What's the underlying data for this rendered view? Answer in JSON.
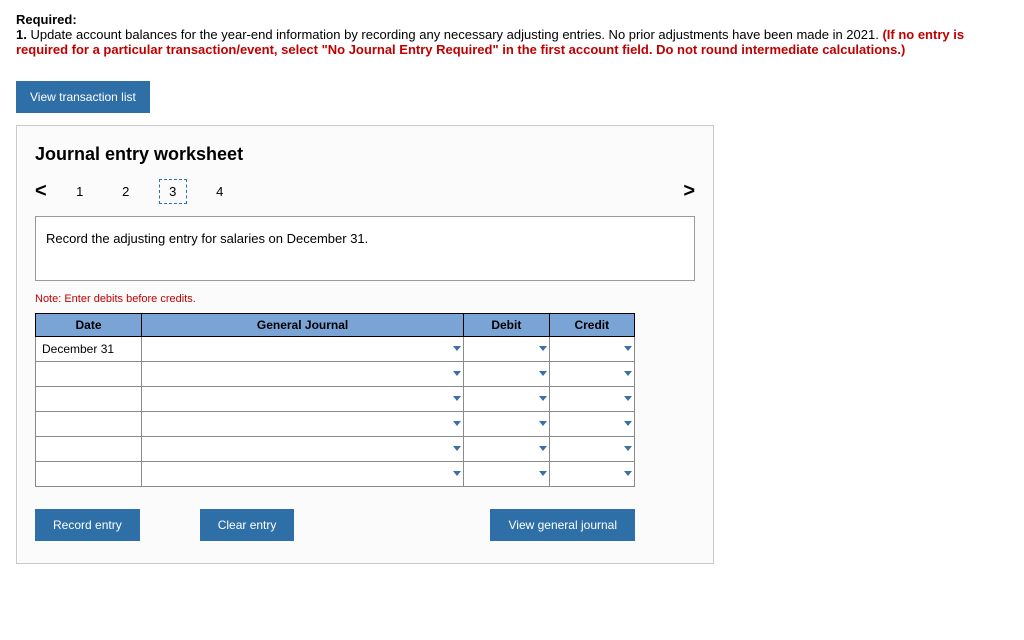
{
  "required": {
    "heading": "Required:",
    "item_num": "1.",
    "text_a": " Update account balances for the year-end information by recording any necessary adjusting entries. No prior adjustments have been made in 2021. ",
    "text_red": "(If no entry is required for a particular transaction/event, select \"No Journal Entry Required\" in the first account field. Do not round intermediate calculations.)"
  },
  "buttons": {
    "view_transaction_list": "View transaction list",
    "record_entry": "Record entry",
    "clear_entry": "Clear entry",
    "view_general_journal": "View general journal"
  },
  "worksheet": {
    "title": "Journal entry worksheet",
    "pager": {
      "prev": "<",
      "next": ">",
      "steps": [
        "1",
        "2",
        "3",
        "4"
      ],
      "current_index": 2
    },
    "instruction": "Record the adjusting entry for salaries on December 31.",
    "note": "Note: Enter debits before credits.",
    "table": {
      "headers": {
        "date": "Date",
        "general_journal": "General Journal",
        "debit": "Debit",
        "credit": "Credit"
      },
      "rows": [
        {
          "date": "December 31",
          "gj": "",
          "debit": "",
          "credit": ""
        },
        {
          "date": "",
          "gj": "",
          "debit": "",
          "credit": ""
        },
        {
          "date": "",
          "gj": "",
          "debit": "",
          "credit": ""
        },
        {
          "date": "",
          "gj": "",
          "debit": "",
          "credit": ""
        },
        {
          "date": "",
          "gj": "",
          "debit": "",
          "credit": ""
        },
        {
          "date": "",
          "gj": "",
          "debit": "",
          "credit": ""
        }
      ]
    }
  }
}
